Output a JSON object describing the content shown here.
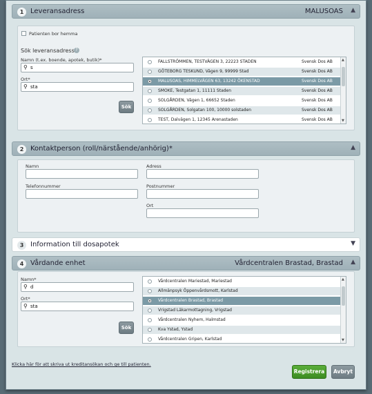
{
  "section1": {
    "number": "1",
    "title": "Leveransadress",
    "right_text": "MALUSOAS",
    "checkbox_label": "Patienten bor hemma",
    "search_heading": "Sök leveransadress",
    "name_label": "Namn (t.ex. boende, apotek, butik)*",
    "name_value": "s",
    "ort_label": "Ort*",
    "ort_value": "sta",
    "search_button": "Sök",
    "results": [
      {
        "name": "FALLSTRÖMMEN, TESTVÄGEN 3, 22223 STADEN",
        "supplier": "Svensk Dos AB",
        "selected": false
      },
      {
        "name": "GÖTEBORG TESKUND, Vägen 9, 99999 Stad",
        "supplier": "Svensk Dos AB",
        "selected": false
      },
      {
        "name": "MALUSOAS, HIMMELVÄGEN 63, 13242 ÖKENSTAD",
        "supplier": "Svensk Dos AB",
        "selected": true
      },
      {
        "name": "SMOKE, Testgatan 1, 11111 Staden",
        "supplier": "Svensk Dos AB",
        "selected": false
      },
      {
        "name": "SOLGÅRDEN, Vägen 1, 66652 Staden",
        "supplier": "Svensk Dos AB",
        "selected": false
      },
      {
        "name": "SOLGÅRDEN, Solgatan 100, 10000 solstaden",
        "supplier": "Svensk Dos AB",
        "selected": false
      },
      {
        "name": "TEST, Dalvägen 1, 12345 Arenastaden",
        "supplier": "Svensk Dos AB",
        "selected": false
      }
    ]
  },
  "section2": {
    "number": "2",
    "title": "Kontaktperson (roll/närstående/anhörig)*",
    "namn_label": "Namn",
    "adress_label": "Adress",
    "telefon_label": "Telefonnummer",
    "postnummer_label": "Postnummer",
    "ort_label": "Ort"
  },
  "section3": {
    "number": "3",
    "title": "Information till dosapotek"
  },
  "section4": {
    "number": "4",
    "title": "Vårdande enhet",
    "right_text": "Vårdcentralen Brastad, Brastad",
    "name_label": "Namn*",
    "name_value": "d",
    "ort_label": "Ort*",
    "ort_value": "sta",
    "search_button": "Sök",
    "results": [
      {
        "name": "Vårdcentralen Mariestad, Mariestad",
        "selected": false
      },
      {
        "name": "Allmänpsyk Öppenvårdsmott, Karlstad",
        "selected": false
      },
      {
        "name": "Vårdcentralen Brastad, Brastad",
        "selected": true
      },
      {
        "name": "Vrigstad Läkarmottagning, Vrigstad",
        "selected": false
      },
      {
        "name": "Vårdcentralen Nyhem, Halmstad",
        "selected": false
      },
      {
        "name": "Kva Ystad, Ystad",
        "selected": false
      },
      {
        "name": "Vårdcentralen Gripen, Karlstad",
        "selected": false
      }
    ]
  },
  "footer": {
    "link_text": "Klicka här för att skriva ut kreditansökan och ge till patienten.",
    "register_button": "Registrera",
    "cancel_button": "Avbryt"
  },
  "icons": {
    "chevron_up": "chevron-up-icon",
    "chevron_down": "chevron-down-icon",
    "search": "search-icon",
    "help": "help-icon"
  }
}
